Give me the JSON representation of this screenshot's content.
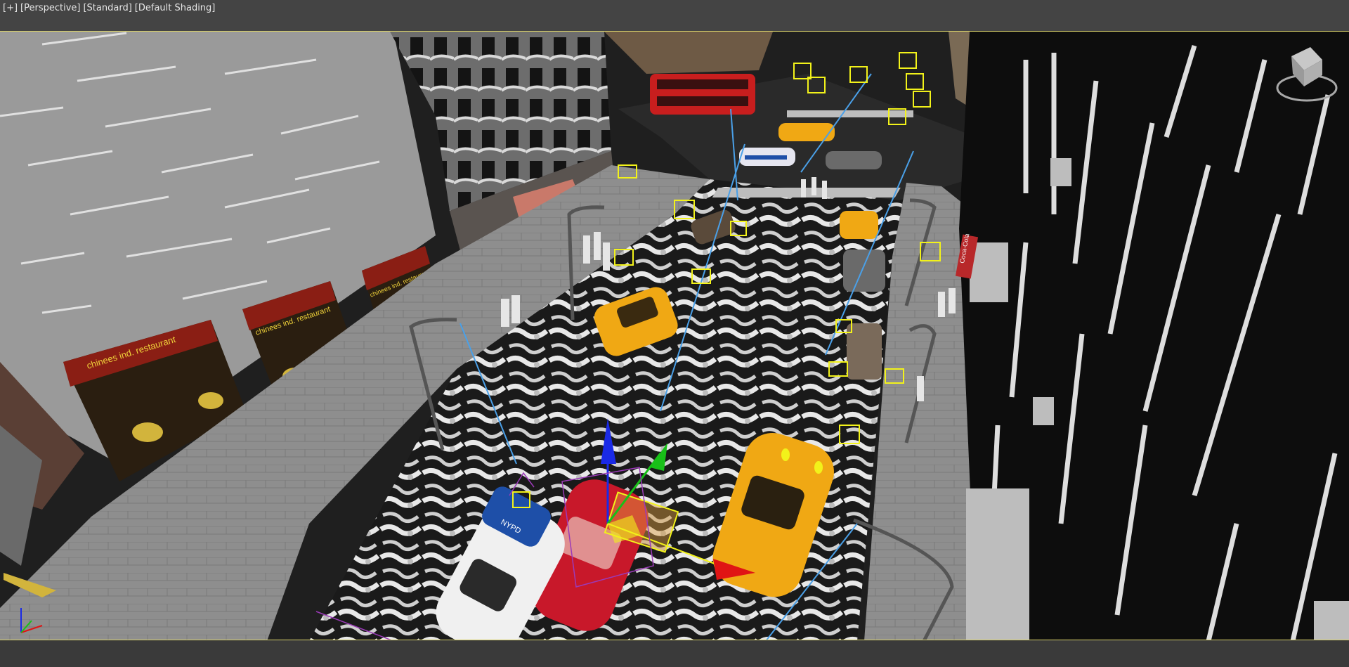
{
  "viewport": {
    "labels": [
      "[+]",
      "[Perspective]",
      "[Standard]",
      "[Default Shading]"
    ]
  },
  "scene": {
    "signs": {
      "restaurant_1": "chinees ind. restaurant",
      "restaurant_2": "chinees ind. restaurant",
      "restaurant_3": "chinees ind. restaurant",
      "police_car": "NYPD",
      "coca_cola": "Coca-Cola"
    },
    "colors": {
      "taxi": "#f0a814",
      "bus": "#c81e1e",
      "red_car": "#c8182a",
      "police_blue": "#1e4fa8",
      "helper_yellow": "#f2f21a",
      "light_line": "#4aa0e8",
      "gizmo_x": "#e01414",
      "gizmo_y": "#18c018",
      "gizmo_z": "#1a2ae6"
    }
  }
}
